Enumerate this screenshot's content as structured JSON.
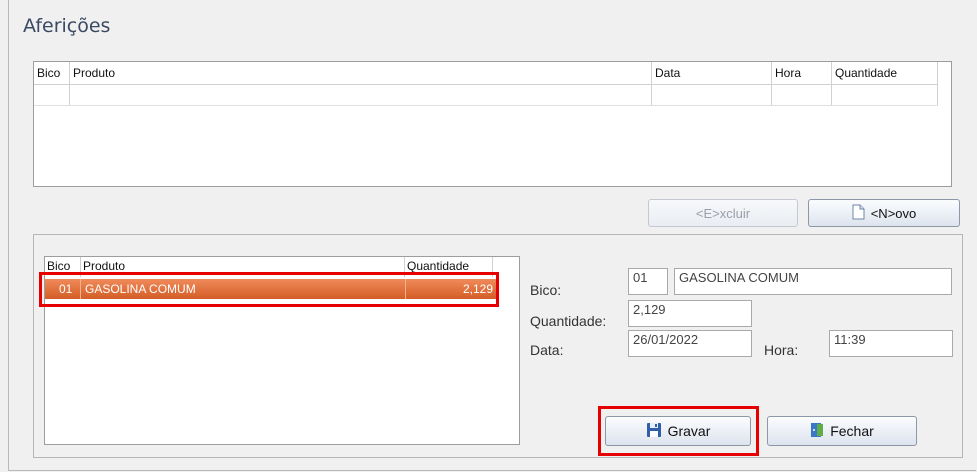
{
  "window": {
    "title": "Aferições"
  },
  "afericoes_grid": {
    "columns": [
      "Bico",
      "Produto",
      "Data",
      "Hora",
      "Quantidade"
    ]
  },
  "buttons": {
    "excluir": "<E>xcluir",
    "novo": "<N>ovo",
    "gravar": "Gravar",
    "fechar": "Fechar"
  },
  "bicos_grid": {
    "columns": [
      "Bico",
      "Produto",
      "Quantidade"
    ],
    "rows": [
      {
        "bico": "01",
        "produto": "GASOLINA COMUM",
        "quantidade": "2,129"
      }
    ]
  },
  "form": {
    "bico_label": "Bico:",
    "bico_code": "01",
    "bico_name": "GASOLINA COMUM",
    "quantidade_label": "Quantidade:",
    "quantidade_value": "2,129",
    "data_label": "Data:",
    "data_value": "26/01/2022",
    "hora_label": "Hora:",
    "hora_value": "11:39"
  },
  "colors": {
    "selection": "#d45d26",
    "highlight": "#e60000",
    "title": "#3b4a63"
  },
  "icons": {
    "novo": "new-document-icon",
    "gravar": "floppy-disk-icon",
    "fechar": "exit-door-icon"
  }
}
